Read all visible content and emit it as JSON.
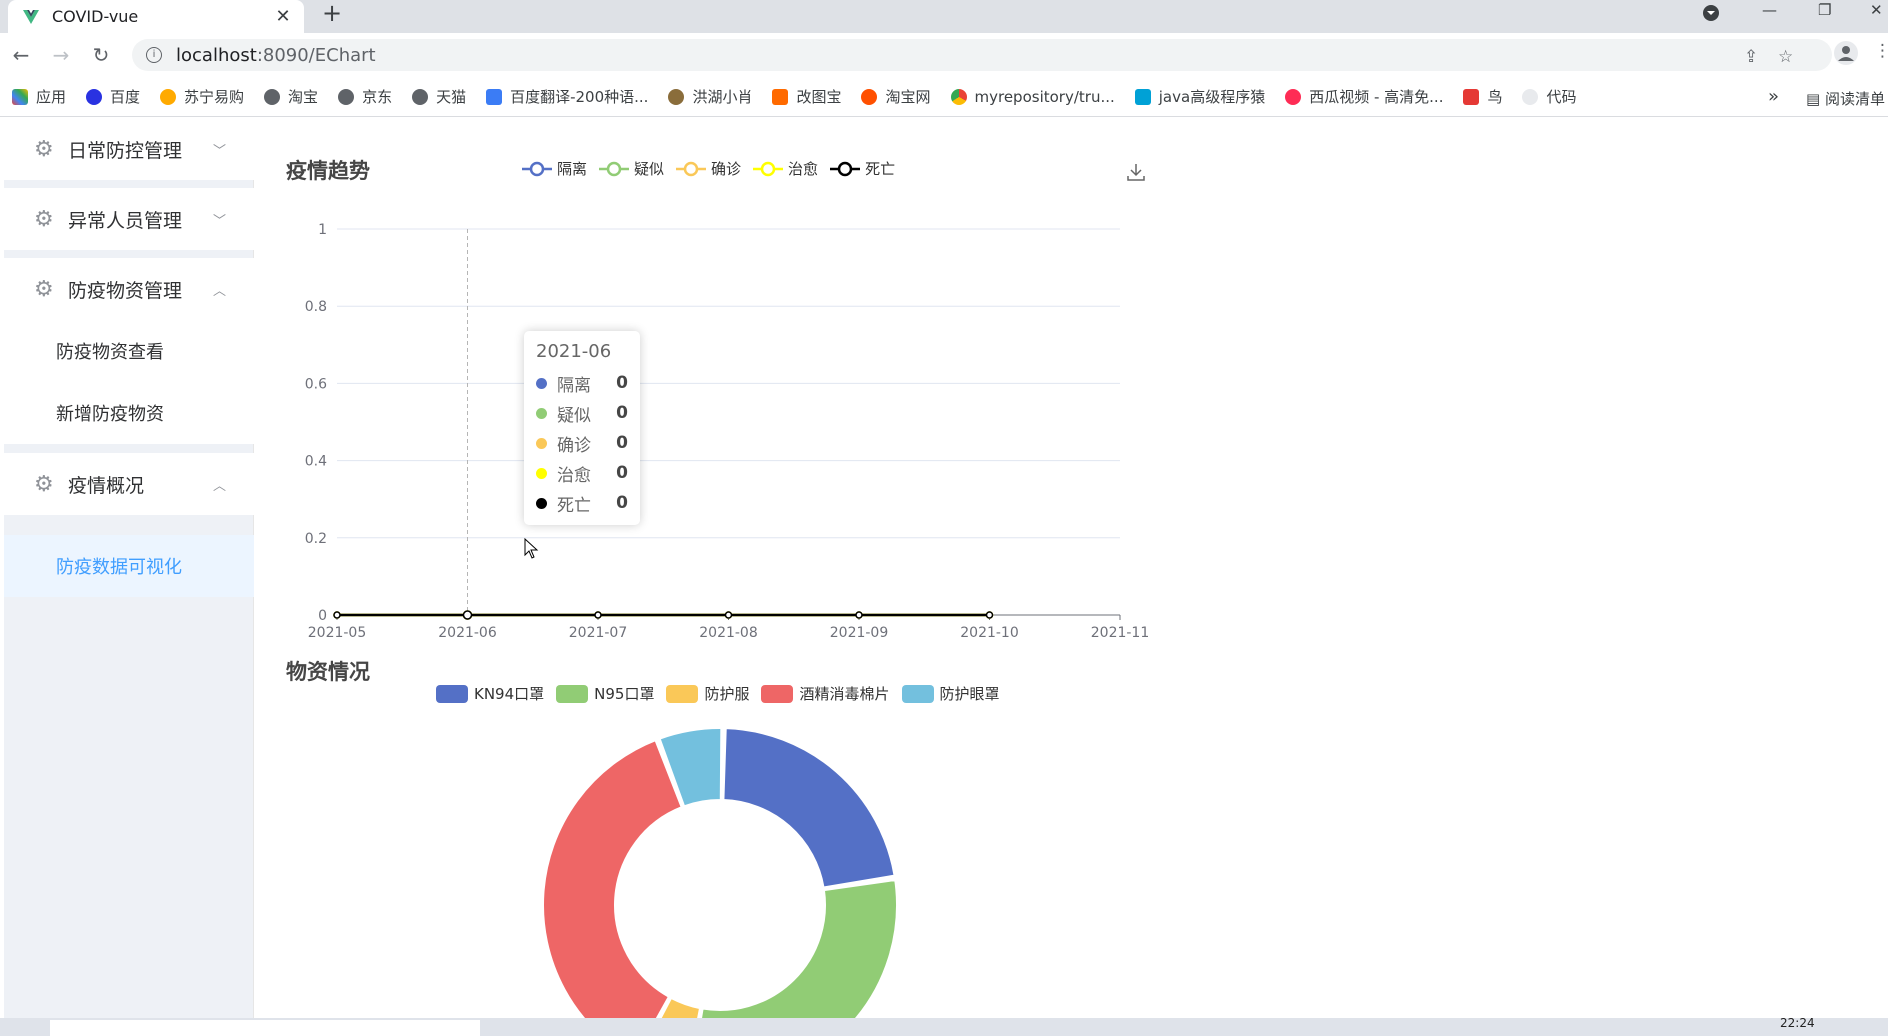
{
  "browser": {
    "tab_title": "COVID-vue",
    "url_host": "localhost",
    "url_path": ":8090/EChart",
    "bookmarks": [
      "应用",
      "百度",
      "苏宁易购",
      "淘宝",
      "京东",
      "天猫",
      "百度翻译-200种语...",
      "洪湖小肖",
      "改图宝",
      "淘宝网",
      "myrepository/tru...",
      "java高级程序猿",
      "西瓜视频 - 高清免...",
      "鸟",
      "代码"
    ],
    "bookmarks_more": "»",
    "reading_list": "阅读清单"
  },
  "sidebar": {
    "groups": [
      {
        "label": "日常防控管理",
        "arrow": "expand"
      },
      {
        "label": "异常人员管理",
        "arrow": "expand"
      },
      {
        "label": "防疫物资管理",
        "arrow": "collapse"
      },
      {
        "label": "疫情概况",
        "arrow": "collapse"
      }
    ],
    "sub_items": [
      "防疫物资查看",
      "新增防疫物资",
      "防疫数据可视化"
    ]
  },
  "trend": {
    "title": "疫情趋势",
    "tooltip": {
      "date": "2021-06",
      "rows": [
        {
          "name": "隔离",
          "value": "0"
        },
        {
          "name": "疑似",
          "value": "0"
        },
        {
          "name": "确诊",
          "value": "0"
        },
        {
          "name": "治愈",
          "value": "0"
        },
        {
          "name": "死亡",
          "value": "0"
        }
      ]
    }
  },
  "supplies": {
    "title": "物资情况"
  },
  "taskbar": {
    "clock": "22:24"
  },
  "colors": {
    "blue": "#5470c6",
    "green": "#91cc75",
    "orange": "#fac858",
    "red": "#ee6666",
    "cyan": "#73c0de",
    "yellow": "#ffff00",
    "black": "#000000",
    "accent": "#409eff"
  },
  "chart_data": [
    {
      "type": "line",
      "title": "疫情趋势",
      "x": [
        "2021-05",
        "2021-06",
        "2021-07",
        "2021-08",
        "2021-09",
        "2021-10",
        "2021-11"
      ],
      "ylim": [
        0,
        1
      ],
      "yticks": [
        0,
        0.2,
        0.4,
        0.6,
        0.8,
        1
      ],
      "series": [
        {
          "name": "隔离",
          "color": "#5470c6",
          "values": [
            0,
            0,
            0,
            0,
            0,
            0
          ]
        },
        {
          "name": "疑似",
          "color": "#91cc75",
          "values": [
            0,
            0,
            0,
            0,
            0,
            0
          ]
        },
        {
          "name": "确诊",
          "color": "#fac858",
          "values": [
            0,
            0,
            0,
            0,
            0,
            0
          ]
        },
        {
          "name": "治愈",
          "color": "#ffff00",
          "values": [
            0,
            0,
            0,
            0,
            0,
            0
          ]
        },
        {
          "name": "死亡",
          "color": "#000000",
          "values": [
            0,
            0,
            0,
            0,
            0,
            0
          ]
        }
      ],
      "legend": "top",
      "grid": true
    },
    {
      "type": "pie",
      "title": "物资情况",
      "labels": [
        "KN94口罩",
        "N95口罩",
        "防护服",
        "酒精消毒棉片",
        "防护眼罩"
      ],
      "values": [
        22,
        30,
        5,
        36,
        6
      ],
      "colors": [
        "#5470c6",
        "#91cc75",
        "#fac858",
        "#ee6666",
        "#73c0de"
      ],
      "legend": "top"
    }
  ]
}
